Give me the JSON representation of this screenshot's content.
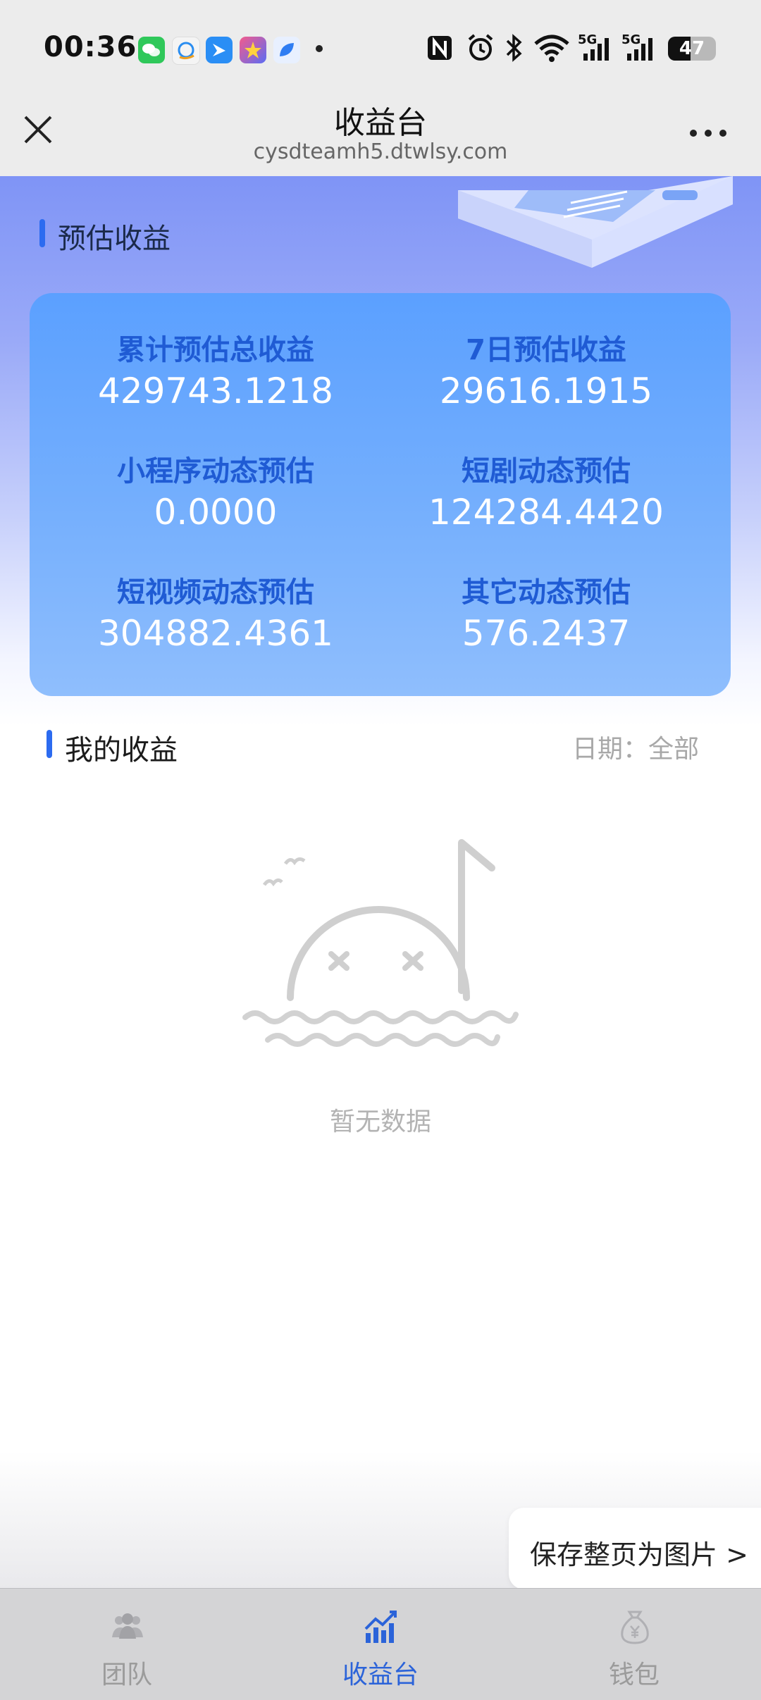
{
  "status_bar": {
    "time": "00:36",
    "network_1": "5G",
    "network_2": "5G",
    "battery": "47"
  },
  "titlebar": {
    "title": "收益台",
    "domain": "cysdteamh5.dtwlsy.com"
  },
  "estimated": {
    "section_title": "预估收益",
    "stats": [
      {
        "label": "累计预估总收益",
        "value": "429743.1218"
      },
      {
        "label": "7日预估收益",
        "value": "29616.1915"
      },
      {
        "label": "小程序动态预估",
        "value": "0.0000"
      },
      {
        "label": "短剧动态预估",
        "value": "124284.4420"
      },
      {
        "label": "短视频动态预估",
        "value": "304882.4361"
      },
      {
        "label": "其它动态预估",
        "value": "576.2437"
      }
    ]
  },
  "my_income": {
    "section_title": "我的收益",
    "date_filter": "日期：全部",
    "empty_text": "暂无数据"
  },
  "save_button": "保存整页为图片 >",
  "tabs": [
    {
      "label": "团队",
      "icon": "team-icon",
      "active": false
    },
    {
      "label": "收益台",
      "icon": "chart-trend-icon",
      "active": true
    },
    {
      "label": "钱包",
      "icon": "money-bag-icon",
      "active": false
    }
  ],
  "colors": {
    "accent": "#2b63d9",
    "card_top": "#5ba0ff",
    "stat_label": "#1f5bd4"
  }
}
